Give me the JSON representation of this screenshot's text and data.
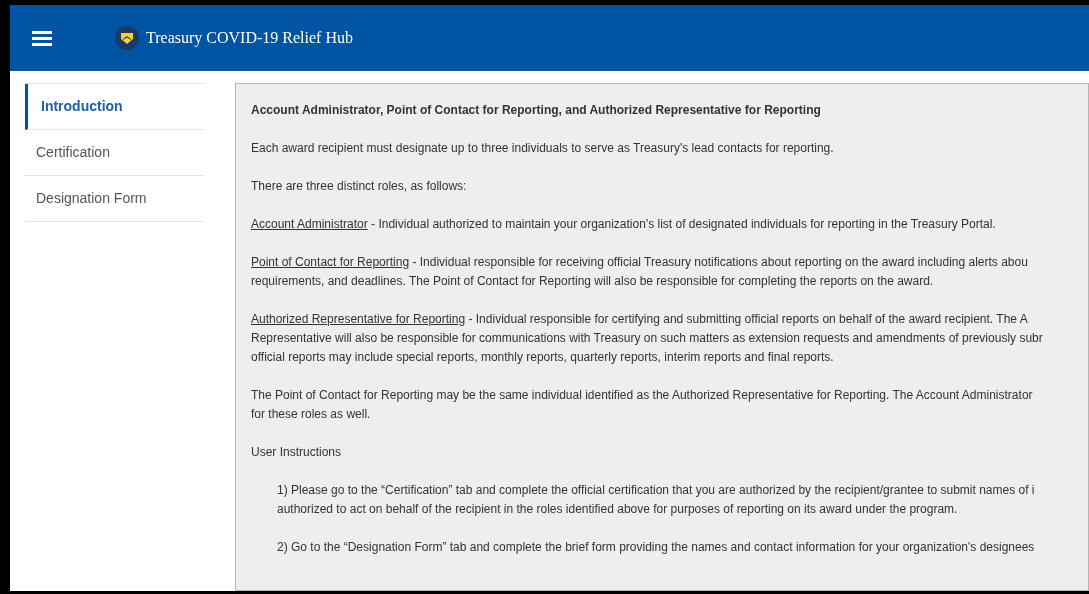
{
  "header": {
    "title": "Treasury COVID-19 Relief Hub"
  },
  "sidebar": {
    "items": [
      {
        "label": "Introduction",
        "selected": true
      },
      {
        "label": "Certification",
        "selected": false
      },
      {
        "label": "Designation Form",
        "selected": false
      }
    ]
  },
  "content": {
    "heading": "Account Administrator, Point of Contact for Reporting, and Authorized Representative for Reporting",
    "paragraphs": [
      {
        "kind": "text",
        "lines": [
          "Each award recipient must designate up to three individuals to serve as Treasury's lead contacts for reporting."
        ]
      },
      {
        "kind": "text",
        "lines": [
          "There are three distinct roles, as follows:"
        ]
      },
      {
        "kind": "role",
        "term": "Account Administrator",
        "lines": [
          " - Individual authorized to maintain your organization's list of designated individuals for reporting in the Treasury Portal."
        ]
      },
      {
        "kind": "role",
        "term": "Point of Contact for Reporting",
        "lines": [
          " - Individual responsible for receiving official Treasury notifications about reporting on the award including alerts abou",
          "requirements, and deadlines. The Point of Contact for Reporting will also be responsible for completing the reports on the award."
        ]
      },
      {
        "kind": "role",
        "term": "Authorized Representative for Reporting",
        "lines": [
          " - Individual responsible for certifying and submitting official reports on behalf of the award recipient. The A",
          "Representative will also be responsible for communications with Treasury on such matters as extension requests and amendments of previously subr",
          "official reports may include special reports, monthly reports, quarterly reports, interim reports and final reports."
        ]
      },
      {
        "kind": "text",
        "lines": [
          "The Point of Contact for Reporting may be the same individual identified as the Authorized Representative for Reporting. The Account Administrator",
          "for these roles as well."
        ]
      },
      {
        "kind": "text",
        "lines": [
          "User Instructions"
        ]
      },
      {
        "kind": "step",
        "lines": [
          "1) Please go to the “Certification” tab and complete the official certification that you are authorized by the recipient/grantee to submit names of i",
          "authorized to act on behalf of the recipient in the roles identified above for purposes of reporting on its award under the program."
        ]
      },
      {
        "kind": "step",
        "lines": [
          "2) Go to the “Designation Form” tab and complete the brief form providing the names and contact information for your organization's designees"
        ]
      }
    ]
  }
}
